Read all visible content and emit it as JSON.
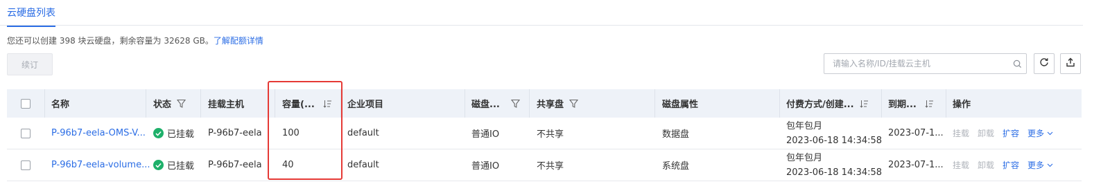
{
  "tabs": {
    "active": "云硬盘列表"
  },
  "quota": {
    "text": "您还可以创建 398 块云硬盘，剩余容量为 32628 GB。",
    "link": "了解配额详情"
  },
  "toolbar": {
    "renew_label": "续订",
    "search_placeholder": "请输入名称/ID/挂载云主机",
    "search_value": ""
  },
  "icons": {
    "search": "search-icon",
    "refresh": "refresh-icon",
    "export": "export-icon",
    "filter": "filter-icon",
    "sort": "sort-icon",
    "check": "check-icon",
    "chevron": "chevron-down-icon"
  },
  "colors": {
    "accent": "#2b6de5",
    "success": "#1eb06a",
    "highlight": "#e53935",
    "header_bg": "#eef2f8"
  },
  "table": {
    "headers": {
      "name": "名称",
      "status": "状态",
      "host": "挂载主机",
      "capacity": "容量(...",
      "project": "企业项目",
      "disk_type": "磁盘...",
      "shared": "共享盘",
      "attribute": "磁盘属性",
      "billing": "付费方式/创建...",
      "expire": "到期...",
      "actions": "操作"
    },
    "rows": [
      {
        "name": "P-96b7-eela-OMS-V...",
        "status": "已挂载",
        "host": "P-96b7-eela",
        "capacity": "100",
        "project": "default",
        "disk_type": "普通IO",
        "shared": "不共享",
        "attribute": "数据盘",
        "billing_mode": "包年包月",
        "created": "2023-06-18 14:34:58",
        "expire": "2023-07-1...",
        "actions": {
          "detach": "挂载",
          "unmount": "卸载",
          "expand": "扩容",
          "more": "更多"
        }
      },
      {
        "name": "P-96b7-eela-volume...",
        "status": "已挂载",
        "host": "P-96b7-eela",
        "capacity": "40",
        "project": "default",
        "disk_type": "普通IO",
        "shared": "不共享",
        "attribute": "系统盘",
        "billing_mode": "包年包月",
        "created": "2023-06-18 14:34:58",
        "expire": "2023-07-1...",
        "actions": {
          "detach": "挂载",
          "unmount": "卸载",
          "expand": "扩容",
          "more": "更多"
        }
      }
    ]
  }
}
